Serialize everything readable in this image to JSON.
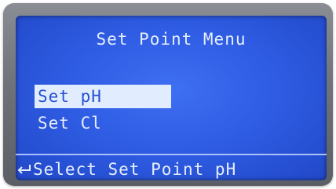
{
  "screen": {
    "title": "Set Point Menu",
    "menu_items": [
      {
        "label": "Set pH",
        "selected": true
      },
      {
        "label": "Set Cl",
        "selected": false
      }
    ],
    "footer_hint": "Select Set Point pH",
    "footer_icon": "enter-arrow-icon"
  },
  "colors": {
    "screen_background": "#2f5de4",
    "text": "#e6eeff",
    "highlight_background": "#e2ecff",
    "highlight_text": "#2550d4"
  }
}
